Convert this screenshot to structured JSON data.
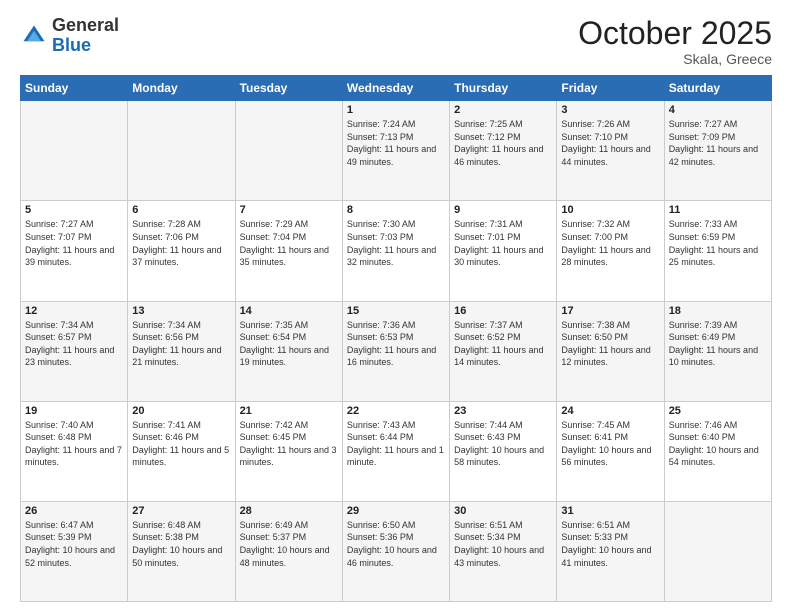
{
  "logo": {
    "general": "General",
    "blue": "Blue"
  },
  "header": {
    "month": "October 2025",
    "location": "Skala, Greece"
  },
  "weekdays": [
    "Sunday",
    "Monday",
    "Tuesday",
    "Wednesday",
    "Thursday",
    "Friday",
    "Saturday"
  ],
  "weeks": [
    [
      {
        "day": "",
        "sunrise": "",
        "sunset": "",
        "daylight": ""
      },
      {
        "day": "",
        "sunrise": "",
        "sunset": "",
        "daylight": ""
      },
      {
        "day": "",
        "sunrise": "",
        "sunset": "",
        "daylight": ""
      },
      {
        "day": "1",
        "sunrise": "Sunrise: 7:24 AM",
        "sunset": "Sunset: 7:13 PM",
        "daylight": "Daylight: 11 hours and 49 minutes."
      },
      {
        "day": "2",
        "sunrise": "Sunrise: 7:25 AM",
        "sunset": "Sunset: 7:12 PM",
        "daylight": "Daylight: 11 hours and 46 minutes."
      },
      {
        "day": "3",
        "sunrise": "Sunrise: 7:26 AM",
        "sunset": "Sunset: 7:10 PM",
        "daylight": "Daylight: 11 hours and 44 minutes."
      },
      {
        "day": "4",
        "sunrise": "Sunrise: 7:27 AM",
        "sunset": "Sunset: 7:09 PM",
        "daylight": "Daylight: 11 hours and 42 minutes."
      }
    ],
    [
      {
        "day": "5",
        "sunrise": "Sunrise: 7:27 AM",
        "sunset": "Sunset: 7:07 PM",
        "daylight": "Daylight: 11 hours and 39 minutes."
      },
      {
        "day": "6",
        "sunrise": "Sunrise: 7:28 AM",
        "sunset": "Sunset: 7:06 PM",
        "daylight": "Daylight: 11 hours and 37 minutes."
      },
      {
        "day": "7",
        "sunrise": "Sunrise: 7:29 AM",
        "sunset": "Sunset: 7:04 PM",
        "daylight": "Daylight: 11 hours and 35 minutes."
      },
      {
        "day": "8",
        "sunrise": "Sunrise: 7:30 AM",
        "sunset": "Sunset: 7:03 PM",
        "daylight": "Daylight: 11 hours and 32 minutes."
      },
      {
        "day": "9",
        "sunrise": "Sunrise: 7:31 AM",
        "sunset": "Sunset: 7:01 PM",
        "daylight": "Daylight: 11 hours and 30 minutes."
      },
      {
        "day": "10",
        "sunrise": "Sunrise: 7:32 AM",
        "sunset": "Sunset: 7:00 PM",
        "daylight": "Daylight: 11 hours and 28 minutes."
      },
      {
        "day": "11",
        "sunrise": "Sunrise: 7:33 AM",
        "sunset": "Sunset: 6:59 PM",
        "daylight": "Daylight: 11 hours and 25 minutes."
      }
    ],
    [
      {
        "day": "12",
        "sunrise": "Sunrise: 7:34 AM",
        "sunset": "Sunset: 6:57 PM",
        "daylight": "Daylight: 11 hours and 23 minutes."
      },
      {
        "day": "13",
        "sunrise": "Sunrise: 7:34 AM",
        "sunset": "Sunset: 6:56 PM",
        "daylight": "Daylight: 11 hours and 21 minutes."
      },
      {
        "day": "14",
        "sunrise": "Sunrise: 7:35 AM",
        "sunset": "Sunset: 6:54 PM",
        "daylight": "Daylight: 11 hours and 19 minutes."
      },
      {
        "day": "15",
        "sunrise": "Sunrise: 7:36 AM",
        "sunset": "Sunset: 6:53 PM",
        "daylight": "Daylight: 11 hours and 16 minutes."
      },
      {
        "day": "16",
        "sunrise": "Sunrise: 7:37 AM",
        "sunset": "Sunset: 6:52 PM",
        "daylight": "Daylight: 11 hours and 14 minutes."
      },
      {
        "day": "17",
        "sunrise": "Sunrise: 7:38 AM",
        "sunset": "Sunset: 6:50 PM",
        "daylight": "Daylight: 11 hours and 12 minutes."
      },
      {
        "day": "18",
        "sunrise": "Sunrise: 7:39 AM",
        "sunset": "Sunset: 6:49 PM",
        "daylight": "Daylight: 11 hours and 10 minutes."
      }
    ],
    [
      {
        "day": "19",
        "sunrise": "Sunrise: 7:40 AM",
        "sunset": "Sunset: 6:48 PM",
        "daylight": "Daylight: 11 hours and 7 minutes."
      },
      {
        "day": "20",
        "sunrise": "Sunrise: 7:41 AM",
        "sunset": "Sunset: 6:46 PM",
        "daylight": "Daylight: 11 hours and 5 minutes."
      },
      {
        "day": "21",
        "sunrise": "Sunrise: 7:42 AM",
        "sunset": "Sunset: 6:45 PM",
        "daylight": "Daylight: 11 hours and 3 minutes."
      },
      {
        "day": "22",
        "sunrise": "Sunrise: 7:43 AM",
        "sunset": "Sunset: 6:44 PM",
        "daylight": "Daylight: 11 hours and 1 minute."
      },
      {
        "day": "23",
        "sunrise": "Sunrise: 7:44 AM",
        "sunset": "Sunset: 6:43 PM",
        "daylight": "Daylight: 10 hours and 58 minutes."
      },
      {
        "day": "24",
        "sunrise": "Sunrise: 7:45 AM",
        "sunset": "Sunset: 6:41 PM",
        "daylight": "Daylight: 10 hours and 56 minutes."
      },
      {
        "day": "25",
        "sunrise": "Sunrise: 7:46 AM",
        "sunset": "Sunset: 6:40 PM",
        "daylight": "Daylight: 10 hours and 54 minutes."
      }
    ],
    [
      {
        "day": "26",
        "sunrise": "Sunrise: 6:47 AM",
        "sunset": "Sunset: 5:39 PM",
        "daylight": "Daylight: 10 hours and 52 minutes."
      },
      {
        "day": "27",
        "sunrise": "Sunrise: 6:48 AM",
        "sunset": "Sunset: 5:38 PM",
        "daylight": "Daylight: 10 hours and 50 minutes."
      },
      {
        "day": "28",
        "sunrise": "Sunrise: 6:49 AM",
        "sunset": "Sunset: 5:37 PM",
        "daylight": "Daylight: 10 hours and 48 minutes."
      },
      {
        "day": "29",
        "sunrise": "Sunrise: 6:50 AM",
        "sunset": "Sunset: 5:36 PM",
        "daylight": "Daylight: 10 hours and 46 minutes."
      },
      {
        "day": "30",
        "sunrise": "Sunrise: 6:51 AM",
        "sunset": "Sunset: 5:34 PM",
        "daylight": "Daylight: 10 hours and 43 minutes."
      },
      {
        "day": "31",
        "sunrise": "Sunrise: 6:51 AM",
        "sunset": "Sunset: 5:33 PM",
        "daylight": "Daylight: 10 hours and 41 minutes."
      },
      {
        "day": "",
        "sunrise": "",
        "sunset": "",
        "daylight": ""
      }
    ]
  ]
}
